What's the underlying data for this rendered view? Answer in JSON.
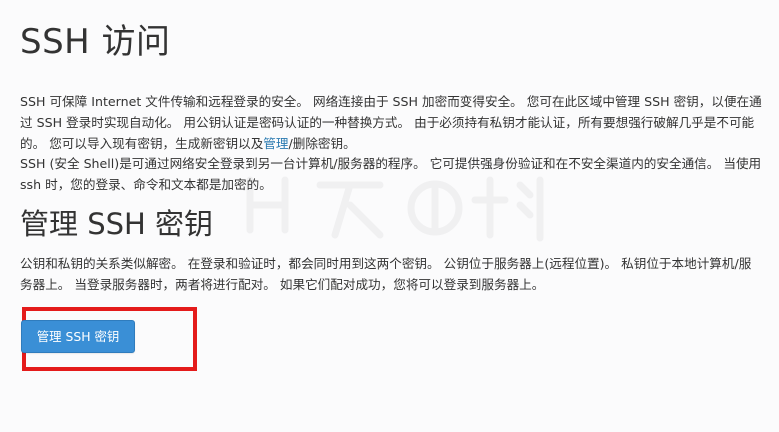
{
  "header": {
    "title": "SSH 访问"
  },
  "intro": {
    "p1_before_link": "SSH 可保障 Internet 文件传输和远程登录的安全。 网络连接由于 SSH 加密而变得安全。 您可在此区域中管理 SSH 密钥，以便在通过 SSH 登录时实现自动化。 用公钥认证是密码认证的一种替换方式。 由于必须持有私钥才能认证，所有要想强行破解几乎是不可能的。 您可以导入现有密钥，生成新密钥以及",
    "p1_link": "管理",
    "p1_after_link": "/删除密钥。",
    "p2": "SSH (安全 Shell)是可通过网络安全登录到另一台计算机/服务器的程序。 它可提供强身份验证和在不安全渠道内的安全通信。 当使用 ssh 时，您的登录、命令和文本都是加密的。"
  },
  "manage_section": {
    "title": "管理 SSH 密钥",
    "description": "公钥和私钥的关系类似解密。 在登录和验证时，都会同时用到这两个密钥。 公钥位于服务器上(远程位置)。 私钥位于本地计算机/服务器上。 当登录服务器时，两者将进行配对。 如果它们配对成功，您将可以登录到服务器上。",
    "button_label": "管理 SSH 密钥"
  },
  "colors": {
    "link": "#2a7ab0",
    "button_bg": "#3a8fd6",
    "highlight": "#e41b1b"
  }
}
